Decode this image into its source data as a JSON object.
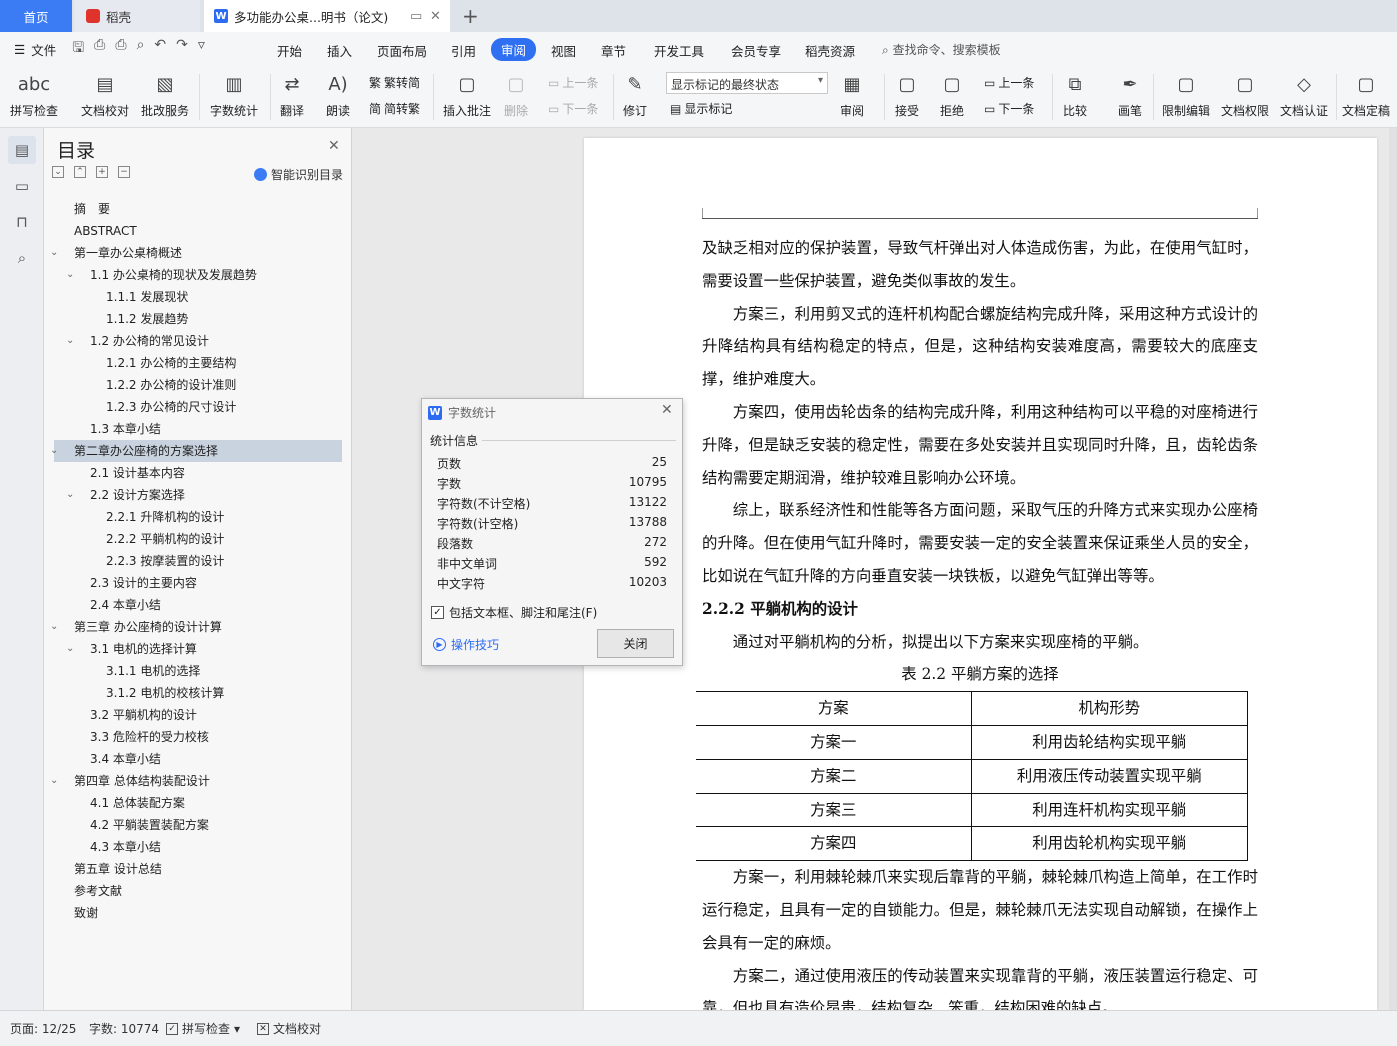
{
  "tabs": {
    "home": "首页",
    "daoke": "稻壳",
    "doc": "多功能办公桌...明书（论文)",
    "new_tab": "+"
  },
  "menubar": {
    "file": "文件",
    "items": [
      "开始",
      "插入",
      "页面布局",
      "引用",
      "审阅",
      "视图",
      "章节",
      "开发工具",
      "会员专享",
      "稻壳资源"
    ],
    "active": "审阅",
    "search": "查找命令、搜索模板"
  },
  "ribbon": {
    "spellcheck": "拼写检查",
    "doc_proof": "文档校对",
    "revise_service": "批改服务",
    "word_count": "字数统计",
    "translate": "翻译",
    "read_aloud": "朗读",
    "trad_simp": "繁转简",
    "simp_trad": "简转繁",
    "insert_comment": "插入批注",
    "delete": "删除",
    "prev": "上一条",
    "next": "下一条",
    "track": "修订",
    "markup_select": "显示标记的最终状态",
    "show_markup": "显示标记",
    "review": "审阅",
    "accept": "接受",
    "reject": "拒绝",
    "prev2": "上一条",
    "next2": "下一条",
    "compare": "比较",
    "ink": "画笔",
    "restrict": "限制编辑",
    "permission": "文档权限",
    "certify": "文档认证",
    "finalize": "文档定稿"
  },
  "toc": {
    "title": "目录",
    "smart": "智能识别目录",
    "items": [
      {
        "text": "摘　要",
        "level": 0,
        "chev": ""
      },
      {
        "text": "ABSTRACT",
        "level": 0,
        "chev": ""
      },
      {
        "text": "第一章办公桌椅概述",
        "level": 0,
        "chev": "v"
      },
      {
        "text": "1.1  办公桌椅的现状及发展趋势",
        "level": 1,
        "chev": "v"
      },
      {
        "text": "1.1.1  发展现状",
        "level": 2,
        "chev": ""
      },
      {
        "text": "1.1.2  发展趋势",
        "level": 2,
        "chev": ""
      },
      {
        "text": "1.2 办公椅的常见设计",
        "level": 1,
        "chev": "v"
      },
      {
        "text": "1.2.1  办公椅的主要结构",
        "level": 2,
        "chev": ""
      },
      {
        "text": "1.2.2  办公椅的设计准则",
        "level": 2,
        "chev": ""
      },
      {
        "text": "1.2.3  办公椅的尺寸设计",
        "level": 2,
        "chev": ""
      },
      {
        "text": "1.3  本章小结",
        "level": 1,
        "chev": ""
      },
      {
        "text": "第二章办公座椅的方案选择",
        "level": 0,
        "chev": "v",
        "selected": true
      },
      {
        "text": "2.1  设计基本内容",
        "level": 1,
        "chev": ""
      },
      {
        "text": "2.2  设计方案选择",
        "level": 1,
        "chev": "v"
      },
      {
        "text": "2.2.1  升降机构的设计",
        "level": 2,
        "chev": ""
      },
      {
        "text": "2.2.2  平躺机构的设计",
        "level": 2,
        "chev": ""
      },
      {
        "text": "2.2.3  按摩装置的设计",
        "level": 2,
        "chev": ""
      },
      {
        "text": "2.3 设计的主要内容",
        "level": 1,
        "chev": ""
      },
      {
        "text": "2.4  本章小结",
        "level": 1,
        "chev": ""
      },
      {
        "text": "第三章  办公座椅的设计计算",
        "level": 0,
        "chev": "v"
      },
      {
        "text": "3.1 电机的选择计算",
        "level": 1,
        "chev": "v"
      },
      {
        "text": "3.1.1 电机的选择",
        "level": 2,
        "chev": ""
      },
      {
        "text": "3.1.2 电机的校核计算",
        "level": 2,
        "chev": ""
      },
      {
        "text": "3.2 平躺机构的设计",
        "level": 1,
        "chev": ""
      },
      {
        "text": "3.3 危险杆的受力校核",
        "level": 1,
        "chev": ""
      },
      {
        "text": "3.4 本章小结",
        "level": 1,
        "chev": ""
      },
      {
        "text": "第四章  总体结构装配设计",
        "level": 0,
        "chev": "v"
      },
      {
        "text": "4.1 总体装配方案",
        "level": 1,
        "chev": ""
      },
      {
        "text": "4.2  平躺装置装配方案",
        "level": 1,
        "chev": ""
      },
      {
        "text": "4.3 本章小结",
        "level": 1,
        "chev": ""
      },
      {
        "text": "第五章  设计总结",
        "level": 0,
        "chev": ""
      },
      {
        "text": "参考文献",
        "level": 0,
        "chev": ""
      },
      {
        "text": "致谢",
        "level": 0,
        "chev": ""
      }
    ]
  },
  "dialog": {
    "title": "字数统计",
    "section": "统计信息",
    "rows": [
      {
        "label": "页数",
        "value": "25"
      },
      {
        "label": "字数",
        "value": "10795"
      },
      {
        "label": "字符数(不计空格)",
        "value": "13122"
      },
      {
        "label": "字符数(计空格)",
        "value": "13788"
      },
      {
        "label": "段落数",
        "value": "272"
      },
      {
        "label": "非中文单词",
        "value": "592"
      },
      {
        "label": "中文字符",
        "value": "10203"
      }
    ],
    "checkbox": "包括文本框、脚注和尾注(F)",
    "tips": "操作技巧",
    "close": "关闭"
  },
  "document": {
    "p1": "及缺乏相对应的保护装置，导致气杆弹出对人体造成伤害，为此，在使用气缸时，需要设置一些保护装置，避免类似事故的发生。",
    "p2": "方案三，利用剪叉式的连杆机构配合螺旋结构完成升降，采用这种方式设计的升降结构具有结构稳定的特点，但是，这种结构安装难度高，需要较大的底座支撑，维护难度大。",
    "p3": "方案四，使用齿轮齿条的结构完成升降，利用这种结构可以平稳的对座椅进行升降，但是缺乏安装的稳定性，需要在多处安装并且实现同时升降，且，齿轮齿条结构需要定期润滑，维护较难且影响办公环境。",
    "p4": "综上，联系经济性和性能等各方面问题，采取气压的升降方式来实现办公座椅的升降。但在使用气缸升降时，需要安装一定的安全装置来保证乘坐人员的安全，比如说在气缸升降的方向垂直安装一块铁板，以避免气缸弹出等等。",
    "heading": "2.2.2  平躺机构的设计",
    "p5": "通过对平躺机构的分析，拟提出以下方案来实现座椅的平躺。",
    "caption": "表 2.2  平躺方案的选择",
    "table_head": [
      "方案",
      "机构形势"
    ],
    "table_rows": [
      [
        "方案一",
        "利用齿轮结构实现平躺"
      ],
      [
        "方案二",
        "利用液压传动装置实现平躺"
      ],
      [
        "方案三",
        "利用连杆机构实现平躺"
      ],
      [
        "方案四",
        "利用齿轮机构实现平躺"
      ]
    ],
    "p6": "方案一，利用棘轮棘爪来实现后靠背的平躺，棘轮棘爪构造上简单，在工作时运行稳定，且具有一定的自锁能力。但是，棘轮棘爪无法实现自动解锁，在操作上会具有一定的麻烦。",
    "p7": "方案二，通过使用液压的传动装置来实现靠背的平躺，液压装置运行稳定、可靠，但也具有造价昂贵，结构复杂、笨重，结构困难的缺点。"
  },
  "status": {
    "page": "页面: 12/25",
    "words": "字数: 10774",
    "spell": "拼写检查",
    "proof": "文档校对"
  }
}
